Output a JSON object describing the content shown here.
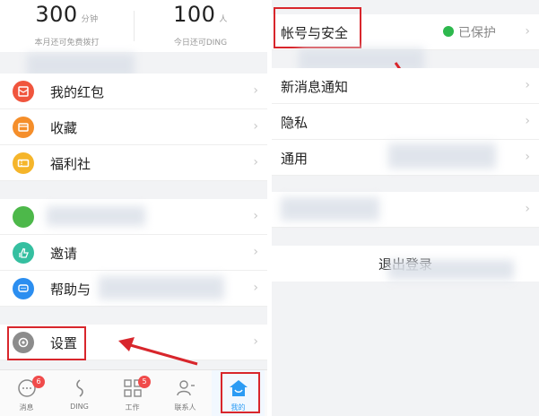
{
  "stats": [
    {
      "value": "300",
      "unit": "分钟",
      "caption": "本月还可免费拨打"
    },
    {
      "value": "100",
      "unit": "人",
      "caption": "今日还可DING"
    }
  ],
  "menu": {
    "red_packet": "我的红包",
    "favorites": "收藏",
    "benefits": "福利社",
    "invite": "邀请",
    "help": "帮助与",
    "settings": "设置"
  },
  "tabs": [
    {
      "label": "消息",
      "badge": "6"
    },
    {
      "label": "DING",
      "badge": ""
    },
    {
      "label": "工作",
      "badge": "5"
    },
    {
      "label": "联系人",
      "badge": ""
    },
    {
      "label": "我的",
      "badge": ""
    }
  ],
  "settings_page": {
    "account_security": "帐号与安全",
    "account_status": "已保护",
    "new_message_notice": "新消息通知",
    "privacy": "隐私",
    "general": "通用",
    "logout": "退出登录"
  },
  "colors": {
    "highlight_red": "#d8262c",
    "active_tab_blue": "#2b9bf4",
    "protected_green": "#2db84d"
  }
}
